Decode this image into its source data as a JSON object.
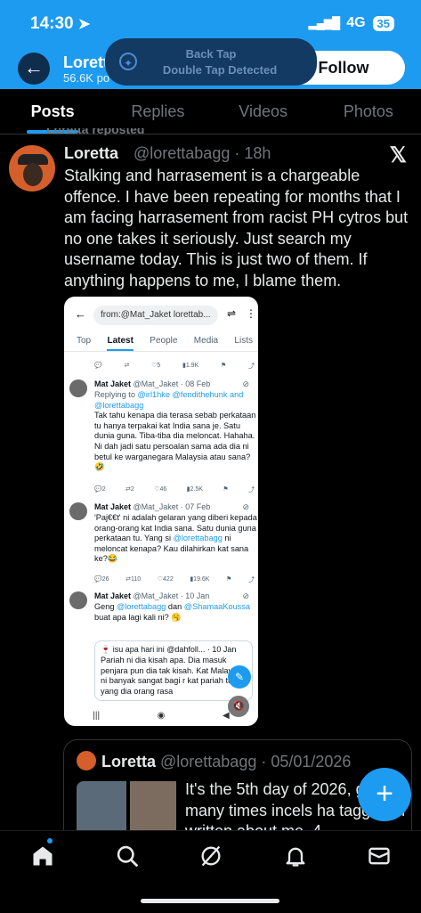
{
  "status": {
    "time": "14:30",
    "network": "4G",
    "battery": "35"
  },
  "header": {
    "name": "Loretta",
    "count": "56.6K po",
    "follow_label": "Follow"
  },
  "toast": {
    "line1": "Back Tap",
    "line2": "Double Tap Detected"
  },
  "tabs": [
    "Posts",
    "Replies",
    "Videos",
    "Photos"
  ],
  "tweet": {
    "reposted": "Loretta reposted",
    "name": "Loretta",
    "handle": "@lorettabagg · 18h",
    "text": "Stalking and harrasement is a chargeable offence. I have been repeating for months that I am facing harrasement from racist PH cytros but no one takes it seriously.  Just search my username today. This is just two of them. If anything happens to me, I blame them."
  },
  "media": {
    "search_query": "from:@Mat_Jaket lorettab...",
    "tabs": [
      "Top",
      "Latest",
      "People",
      "Media",
      "Lists"
    ],
    "top_actions": [
      "5",
      "1.9K"
    ],
    "tweets": [
      {
        "name": "Mat Jaket",
        "meta": "@Mat_Jaket · 08 Feb",
        "replying": "Replying to",
        "replying_handles": "@irl1hke @fendithehunk and @lorettabagg",
        "text": "Tak tahu kenapa dia terasa sebab perkataan tu hanya terpakai kat India sana je. Satu dunia guna. Tiba-tiba dia meloncat. Hahaha. Ni dah jadi satu persoalan sama ada dia ni betul ke warganegara Malaysia atau sana?🤣",
        "replies": "2",
        "reposts": "2",
        "likes": "46",
        "views": "2.5K"
      },
      {
        "name": "Mat Jaket",
        "meta": "@Mat_Jaket · 07 Feb",
        "text_before": "'Paj€€t' ni adalah gelaran yang diberi kepada orang-orang kat India sana. Satu dunia guna perkataan tu. Yang si ",
        "mention": "@lorettabagg",
        "text_after": " ni meloncat kenapa? Kau dilahirkan kat sana ke?😂",
        "replies": "26",
        "reposts": "110",
        "likes": "422",
        "views": "19.6K"
      },
      {
        "name": "Mat Jaket",
        "meta": "@Mat_Jaket · 10 Jan",
        "text_before": "Geng ",
        "mention1": "@lorettabagg",
        "text_mid": " dan ",
        "mention2": "@ShamaaKoussa",
        "text_after": " buat apa lagi kali ni? 🥱"
      }
    ],
    "quote": {
      "head": "🍷 isu apa hari ini @dahfoll... · 10 Jan",
      "text": "Pariah ni dia kisah apa. Dia masuk penjara pun dia tak kisah. Kat Malaysia ni banyak sangat bagi r kat pariah tu yang dia orang rasa"
    }
  },
  "quote_tweet": {
    "name": "Loretta",
    "handle": "@lorettabagg · 05/01/2026",
    "text": "It's the 5th day of 2026, g how many times incels ha tagged or written about me. 4"
  },
  "nav": {
    "home": "home-icon",
    "search": "search-icon",
    "grok": "grok-icon",
    "notifications": "bell-icon",
    "messages": "mail-icon"
  }
}
